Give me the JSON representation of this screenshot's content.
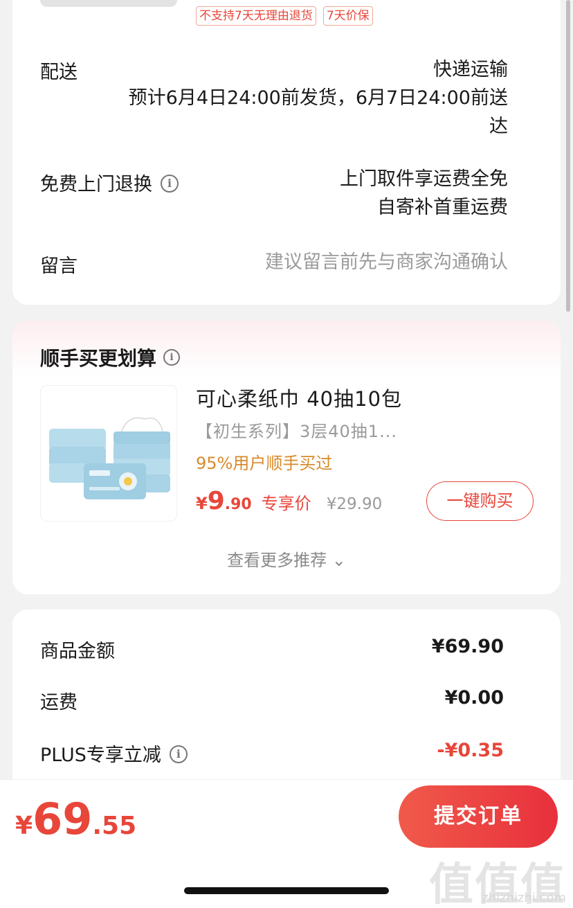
{
  "tags": [
    "不支持7天无理由退货",
    "7天价保"
  ],
  "delivery": {
    "label": "配送",
    "method": "快递运输",
    "eta_line1": "预计6月4日24:00前发货，6月7日24:00前送",
    "eta_line2": "达"
  },
  "return_service": {
    "label": "免费上门退换",
    "line1": "上门取件享运费全免",
    "line2": "自寄补首重运费"
  },
  "message": {
    "label": "留言",
    "placeholder": "建议留言前先与商家沟通确认"
  },
  "recommend": {
    "title": "顺手买更划算",
    "product_name": "可心柔纸巾 40抽10包",
    "product_sub": "【初生系列】3层40抽1...",
    "hint": "95%用户顺手买过",
    "price_symbol": "¥",
    "price_int": "9",
    "price_dec": ".90",
    "price_tag": "专享价",
    "original_price": "¥29.90",
    "buy_label": "一键购买",
    "more_label": "查看更多推荐 ⌄"
  },
  "summary": {
    "rows": [
      {
        "label": "商品金额",
        "value": "¥69.90"
      },
      {
        "label": "运费",
        "value": "¥0.00"
      },
      {
        "label": "PLUS专享立减",
        "value": "-¥0.35"
      }
    ]
  },
  "bottom": {
    "total_symbol": "¥",
    "total_int": "69",
    "total_dec": ".55",
    "submit_label": "提交订单"
  },
  "watermark": {
    "main": "值值值",
    "sub": "zhizhizhi.com"
  },
  "colors": {
    "accent": "#e8463a",
    "hint": "#d88a2a",
    "muted": "#9a9a9a"
  }
}
